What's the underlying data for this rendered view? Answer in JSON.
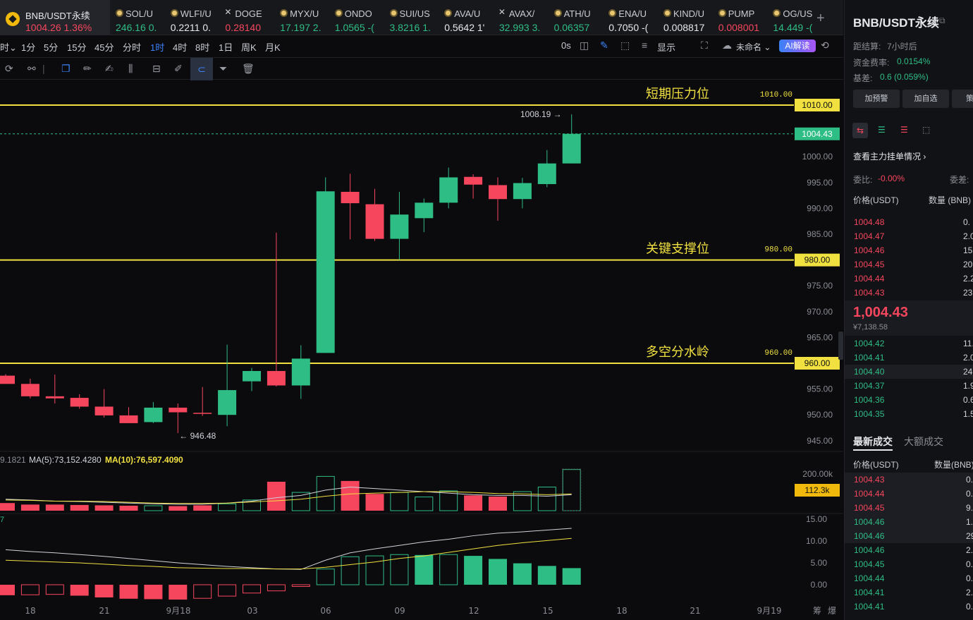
{
  "tickers": [
    {
      "name": "BNB/USDT永续",
      "price": "1004.26",
      "change": "1.36%",
      "icon": "bnb-logo",
      "active": true,
      "color": "red"
    },
    {
      "name": "SOL/U",
      "price": "246.16",
      "change": "0.",
      "icon": "coin-icon",
      "color": "green"
    },
    {
      "name": "WLFI/U",
      "price": "0.2211",
      "change": "0.",
      "icon": "coin-icon",
      "color": "white"
    },
    {
      "name": "DOGE",
      "price": "0.28140",
      "change": "",
      "icon": "x-icon",
      "color": "red"
    },
    {
      "name": "MYX/U",
      "price": "17.197",
      "change": "2.",
      "icon": "coin-icon",
      "color": "green"
    },
    {
      "name": "ONDO",
      "price": "1.0565",
      "change": "-(",
      "icon": "coin-icon",
      "color": "green"
    },
    {
      "name": "SUI/US",
      "price": "3.8216",
      "change": "1.",
      "icon": "coin-icon",
      "color": "green"
    },
    {
      "name": "AVA/U",
      "price": "0.5642",
      "change": "1'",
      "icon": "coin-icon",
      "color": "white"
    },
    {
      "name": "AVAX/",
      "price": "32.993",
      "change": "3.",
      "icon": "x-icon",
      "color": "green"
    },
    {
      "name": "ATH/U",
      "price": "0.06357",
      "change": "",
      "icon": "coin-icon",
      "color": "green"
    },
    {
      "name": "ENA/U",
      "price": "0.7050",
      "change": "-(",
      "icon": "coin-icon",
      "color": "white"
    },
    {
      "name": "KIND/U",
      "price": "0.008817",
      "change": "",
      "icon": "coin-icon",
      "color": "white"
    },
    {
      "name": "PUMP",
      "price": "0.008001",
      "change": "",
      "icon": "coin-icon",
      "color": "red"
    },
    {
      "name": "OG/US",
      "price": "14.449",
      "change": "-(",
      "icon": "coin-icon",
      "color": "green"
    }
  ],
  "timeframes": [
    "1分",
    "5分",
    "15分",
    "45分",
    "分时",
    "1时",
    "4时",
    "8时",
    "1日",
    "周K",
    "月K"
  ],
  "active_timeframe": "1时",
  "toolbar": {
    "menu_partial": "时",
    "countdown": "0s",
    "display_label": "显示",
    "layout_name": "未命名",
    "ai_label": "AI解读"
  },
  "chart_data": {
    "type": "candlestick",
    "x_ticks": [
      "18",
      "21",
      "9月18",
      "03",
      "06",
      "09",
      "12",
      "15",
      "18",
      "21",
      "9月19"
    ],
    "y_ticks": [
      "1000.00",
      "995.00",
      "990.00",
      "985.00",
      "975.00",
      "970.00",
      "965.00",
      "955.00",
      "950.00",
      "945.00"
    ],
    "ylim": [
      942.6,
      1017.4
    ],
    "candles": [
      {
        "o": 957.6,
        "h": 957.9,
        "l": 956.0,
        "c": 956.0
      },
      {
        "o": 956.0,
        "h": 957.0,
        "l": 953.2,
        "c": 953.6
      },
      {
        "o": 953.6,
        "h": 957.8,
        "l": 952.2,
        "c": 953.2
      },
      {
        "o": 953.3,
        "h": 954.0,
        "l": 951.2,
        "c": 951.6
      },
      {
        "o": 951.6,
        "h": 955.0,
        "l": 949.5,
        "c": 949.9
      },
      {
        "o": 949.9,
        "h": 951.5,
        "l": 948.7,
        "c": 948.4
      },
      {
        "o": 948.6,
        "h": 952.5,
        "l": 948.4,
        "c": 951.4
      },
      {
        "o": 951.4,
        "h": 952.2,
        "l": 946.48,
        "c": 950.5
      },
      {
        "o": 950.4,
        "h": 955.4,
        "l": 949.8,
        "c": 950.2
      },
      {
        "o": 950.0,
        "h": 963.6,
        "l": 947.8,
        "c": 954.8
      },
      {
        "o": 956.5,
        "h": 959.1,
        "l": 954.6,
        "c": 958.5
      },
      {
        "o": 958.5,
        "h": 985.3,
        "l": 955.5,
        "c": 955.7
      },
      {
        "o": 955.7,
        "h": 963.5,
        "l": 953.1,
        "c": 960.9
      },
      {
        "o": 962.0,
        "h": 996.0,
        "l": 962.0,
        "c": 993.3
      },
      {
        "o": 993.2,
        "h": 996.7,
        "l": 984.0,
        "c": 991.0
      },
      {
        "o": 990.8,
        "h": 993.8,
        "l": 983.7,
        "c": 984.1
      },
      {
        "o": 984.1,
        "h": 993.2,
        "l": 980.0,
        "c": 988.8
      },
      {
        "o": 988.1,
        "h": 991.9,
        "l": 985.4,
        "c": 991.1
      },
      {
        "o": 991.1,
        "h": 997.9,
        "l": 990.0,
        "c": 996.0
      },
      {
        "o": 996.1,
        "h": 996.6,
        "l": 991.9,
        "c": 994.6
      },
      {
        "o": 994.5,
        "h": 996.0,
        "l": 987.6,
        "c": 991.8
      },
      {
        "o": 991.8,
        "h": 995.9,
        "l": 990.0,
        "c": 994.9
      },
      {
        "o": 994.7,
        "h": 1001.3,
        "l": 994.1,
        "c": 998.7
      },
      {
        "o": 998.7,
        "h": 1008.19,
        "l": 998.7,
        "c": 1004.43
      }
    ],
    "levels": [
      {
        "label": "短期压力位",
        "value": "1010.00",
        "price": 1010
      },
      {
        "label": "关键支撑位",
        "value": "980.00",
        "price": 980
      },
      {
        "label": "多空分水岭",
        "value": "960.00",
        "price": 960
      }
    ],
    "current_price": "1004.43",
    "high_label": "1008.19",
    "low_label": "946.48",
    "volume": {
      "ma_label_partial": "9.1821",
      "ma5_label": "MA(5):73,152.4280",
      "ma10_label": "MA(10):76,597.4090",
      "y_ticks": [
        "200.00k"
      ],
      "current_tag": "112.3k",
      "values": [
        20,
        16,
        16,
        15,
        14,
        13,
        13,
        12,
        14,
        18,
        28,
        76,
        48,
        90,
        78,
        44,
        48,
        36,
        52,
        40,
        37,
        50,
        62,
        108
      ],
      "ma5": [
        30,
        28,
        25,
        24,
        22,
        20,
        18,
        17,
        17,
        20,
        25,
        34,
        40,
        54,
        62,
        58,
        54,
        50,
        46,
        42,
        40,
        40,
        38,
        42
      ],
      "ma10": [
        28,
        27,
        25,
        25,
        24,
        22,
        20,
        19,
        19,
        20,
        23,
        26,
        30,
        38,
        44,
        46,
        48,
        50,
        50,
        48,
        45,
        44,
        42,
        44
      ]
    },
    "macd": {
      "label_partial": "7",
      "y_ticks": [
        "15.00",
        "10.00",
        "5.00",
        "0.00"
      ],
      "ylim": [
        -3,
        17
      ],
      "hist": [
        -2.4,
        -2.3,
        -2.2,
        -2.5,
        -2.9,
        -3.2,
        -3.3,
        -3.4,
        -3.1,
        -2.6,
        -1.9,
        -1.4,
        -0.4,
        3.6,
        6.4,
        6.6,
        6.9,
        6.8,
        6.9,
        6.6,
        5.9,
        4.9,
        4.3,
        3.8
      ],
      "dif": [
        8.0,
        7.6,
        7.3,
        6.9,
        6.5,
        6.0,
        5.5,
        5.0,
        4.6,
        4.2,
        3.9,
        3.6,
        3.5,
        5.6,
        7.3,
        8.2,
        9.0,
        9.8,
        10.4,
        11.2,
        11.8,
        12.1,
        12.5,
        12.9
      ],
      "dea": [
        5.6,
        5.4,
        5.2,
        5.0,
        4.7,
        4.4,
        4.2,
        3.9,
        3.8,
        3.7,
        3.7,
        3.6,
        3.6,
        4.0,
        4.6,
        5.2,
        6.0,
        6.6,
        7.4,
        8.2,
        9.0,
        9.6,
        10.1,
        10.6
      ]
    }
  },
  "sidebar": {
    "title": "BNB/USDT永续",
    "settle_label": "距结算:",
    "settle_value": "7小时后",
    "funding_label": "资金费率:",
    "funding_value": "0.0154%",
    "basis_label": "基差:",
    "basis_value": "0.6 (0.059%)",
    "btn_alert": "加预警",
    "btn_watch": "加自选",
    "btn_more": "策",
    "view_orders": "查看主力挂单情况",
    "ratio_label": "委比:",
    "ratio_value": "-0.00%",
    "diff_label": "委差:",
    "col_price": "价格(USDT)",
    "col_qty": "数量 (BNB)",
    "asks": [
      {
        "p": "1004.48",
        "q": "0."
      },
      {
        "p": "1004.47",
        "q": "2.0"
      },
      {
        "p": "1004.46",
        "q": "15.6"
      },
      {
        "p": "1004.45",
        "q": "20.8"
      },
      {
        "p": "1004.44",
        "q": "2.2"
      },
      {
        "p": "1004.43",
        "q": "23.6"
      }
    ],
    "mid_price": "1,004.43",
    "mid_cny": "¥7,138.58",
    "bids": [
      {
        "p": "1004.42",
        "q": "11.7"
      },
      {
        "p": "1004.41",
        "q": "2.0"
      },
      {
        "p": "1004.40",
        "q": "24.6"
      },
      {
        "p": "1004.37",
        "q": "1.9"
      },
      {
        "p": "1004.36",
        "q": "0.6"
      },
      {
        "p": "1004.35",
        "q": "1.5"
      }
    ],
    "tab_latest": "最新成交",
    "tab_large": "大额成交",
    "trade_col_price": "价格(USDT)",
    "trade_col_qty": "数量(BNB)",
    "trades": [
      {
        "p": "1004.43",
        "q": "0.",
        "c": "red"
      },
      {
        "p": "1004.44",
        "q": "0.",
        "c": "red"
      },
      {
        "p": "1004.45",
        "q": "9.",
        "c": "red"
      },
      {
        "p": "1004.46",
        "q": "1.",
        "c": "green"
      },
      {
        "p": "1004.46",
        "q": "29.",
        "c": "green"
      },
      {
        "p": "1004.46",
        "q": "2.",
        "c": "green"
      },
      {
        "p": "1004.45",
        "q": "0.",
        "c": "green"
      },
      {
        "p": "1004.44",
        "q": "0.",
        "c": "green"
      },
      {
        "p": "1004.41",
        "q": "2.",
        "c": "green"
      },
      {
        "p": "1004.41",
        "q": "0.",
        "c": "green"
      }
    ]
  },
  "colors": {
    "up": "#2ebd85",
    "down": "#f6465d",
    "level": "#f0e040",
    "accent": "#3b82f6",
    "tag": "#f0b90b"
  }
}
